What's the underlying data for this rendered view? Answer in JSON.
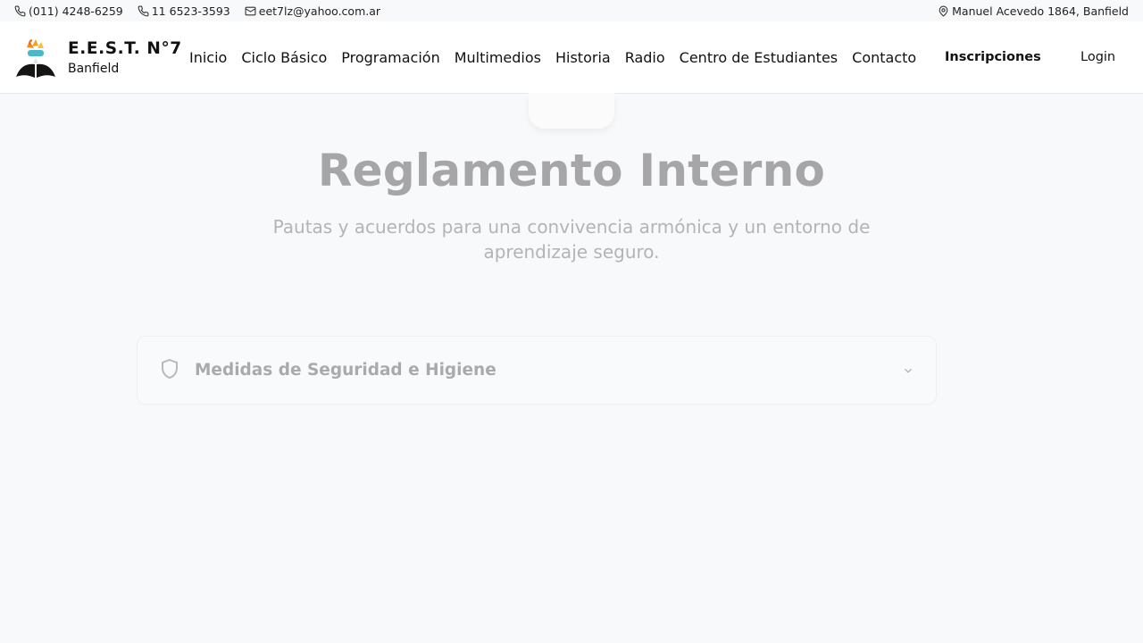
{
  "topbar": {
    "phone1": "(011) 4248-6259",
    "phone2": "11 6523-3593",
    "email": "eet7lz@yahoo.com.ar",
    "address": "Manuel Acevedo 1864, Banfield"
  },
  "brand": {
    "title": "E.E.S.T. N°7",
    "subtitle": "Banfield"
  },
  "nav": {
    "items": [
      "Inicio",
      "Ciclo Básico",
      "Programación",
      "Multimedios",
      "Historia",
      "Radio",
      "Centro de Estudiantes",
      "Contacto"
    ],
    "cta": "Inscripciones",
    "login": "Login"
  },
  "hero": {
    "title": "Reglamento Interno",
    "subtitle": "Pautas y acuerdos para una convivencia armónica y un entorno de aprendizaje seguro."
  },
  "accordion": {
    "label": "Medidas de Seguridad e Higiene",
    "expanded": false
  },
  "colors": {
    "background": "#f8f9fb",
    "muted_title": "#a6a6a9",
    "logo_orange": "#f2a21b",
    "logo_teal": "#49b9c9"
  }
}
